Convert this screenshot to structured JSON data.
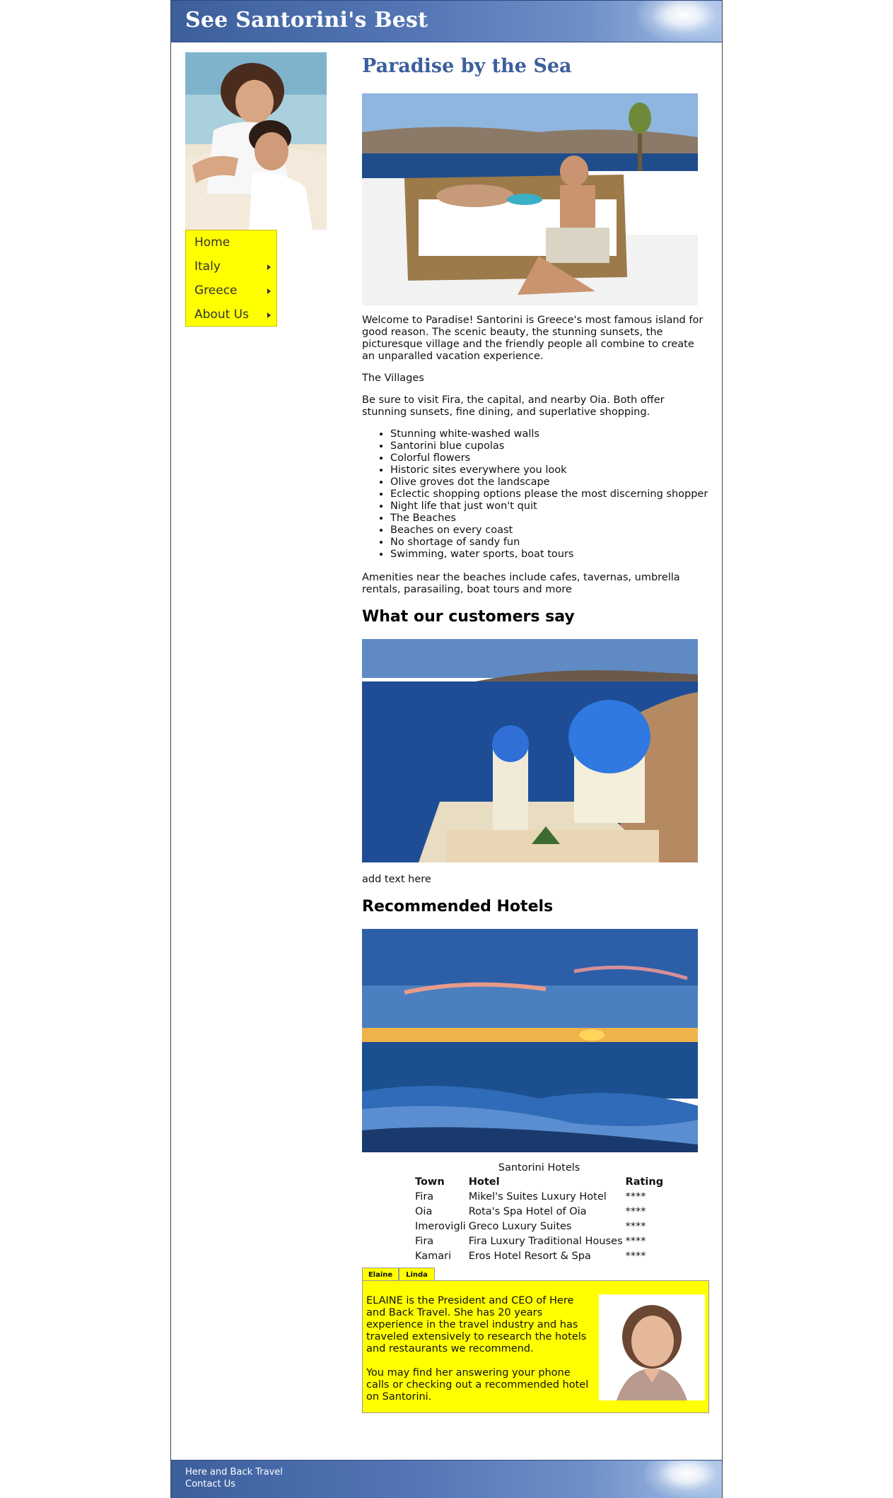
{
  "header": {
    "title": "See Santorini's Best"
  },
  "menu": {
    "items": [
      {
        "label": "Home",
        "has_submenu": false
      },
      {
        "label": "Italy",
        "has_submenu": true
      },
      {
        "label": "Greece",
        "has_submenu": true
      },
      {
        "label": "About Us",
        "has_submenu": true
      }
    ]
  },
  "main": {
    "title": "Paradise by the Sea",
    "intro": "Welcome to Paradise! Santorini is Greece's most famous island for good reason. The scenic beauty, the stunning sunsets, the picturesque village and the friendly people all combine to create an unparalled vacation experience.",
    "villages_heading": "The Villages",
    "villages_text": "Be sure to visit Fira, the capital, and nearby Oia. Both offer stunning sunsets, fine dining, and superlative shopping.",
    "features": [
      "Stunning white-washed walls",
      "Santorini blue cupolas",
      "Colorful flowers",
      "Historic sites everywhere you look",
      "Olive groves dot the landscape",
      "Eclectic shopping options please the most discerning shopper",
      "Night life that just won't quit",
      "The Beaches",
      "Beaches on every coast",
      "No shortage of sandy fun",
      "Swimming, water sports, boat tours"
    ],
    "amenities": "Amenities near the beaches include cafes, tavernas, umbrella rentals, parasailing, boat tours and more",
    "customers_heading": "What our customers say",
    "customers_text": "add text here",
    "hotels_heading": "Recommended Hotels"
  },
  "hotels_table": {
    "caption": "Santorini Hotels",
    "headers": [
      "Town",
      "Hotel",
      "Rating"
    ],
    "rows": [
      [
        "Fira",
        "Mikel's Suites Luxury Hotel",
        "****"
      ],
      [
        "Oia",
        "Rota's Spa Hotel of Oia",
        "****"
      ],
      [
        "Imerovigli",
        "Greco Luxury Suites",
        "****"
      ],
      [
        "Fira",
        "Fira Luxury Traditional Houses",
        "****"
      ],
      [
        "Kamari",
        "Eros Hotel Resort & Spa",
        "****"
      ]
    ]
  },
  "tabs": {
    "labels": [
      "Elaine",
      "Linda"
    ],
    "active": "Elaine",
    "panel": {
      "p1": "ELAINE is the President and CEO of Here and Back Travel. She has 20 years experience in the travel industry and has traveled extensively to research the hotels and restaurants we recommend.",
      "p2": "You may find her answering your phone calls or checking out a recommended hotel on Santorini."
    }
  },
  "footer": {
    "link1": "Here and Back Travel",
    "link2": "Contact Us"
  },
  "colors": {
    "header_blue": "#3c5f9c",
    "title_blue": "#3c5f9c",
    "menu_yellow": "#ffff00",
    "panel_yellow": "#ffff00"
  }
}
